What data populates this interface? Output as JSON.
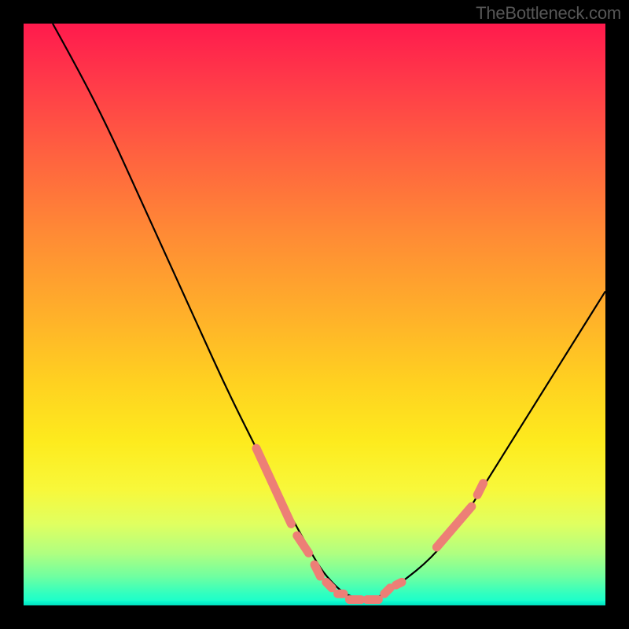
{
  "watermark": "TheBottleneck.com",
  "chart_data": {
    "type": "line",
    "title": "",
    "xlabel": "",
    "ylabel": "",
    "xlim": [
      0,
      100
    ],
    "ylim": [
      0,
      100
    ],
    "grid": false,
    "legend": false,
    "background_gradient": {
      "top": "#ff1a4d",
      "bottom": "#10ffd0",
      "note": "vertical rainbow gradient red→orange→yellow→green"
    },
    "series": [
      {
        "name": "black-curve",
        "color": "#000000",
        "x": [
          5,
          10,
          15,
          20,
          25,
          30,
          35,
          40,
          45,
          50,
          52,
          55,
          58,
          60,
          62,
          65,
          70,
          75,
          80,
          85,
          90,
          95,
          100
        ],
        "y": [
          100,
          91,
          81,
          70,
          59,
          48,
          37,
          27,
          17,
          8,
          5,
          2,
          1,
          1,
          2,
          4,
          8,
          14,
          22,
          30,
          38,
          46,
          54
        ]
      },
      {
        "name": "salmon-dashes",
        "color": "#ed7f76",
        "note": "thick dashed highlight segments on the lower portion of the curve",
        "segments": [
          {
            "from": {
              "x": 40,
              "y": 27
            },
            "to": {
              "x": 46,
              "y": 14
            }
          },
          {
            "from": {
              "x": 47,
              "y": 12
            },
            "to": {
              "x": 49,
              "y": 9
            }
          },
          {
            "from": {
              "x": 50,
              "y": 7
            },
            "to": {
              "x": 51,
              "y": 5
            }
          },
          {
            "from": {
              "x": 52,
              "y": 4
            },
            "to": {
              "x": 53,
              "y": 3
            }
          },
          {
            "from": {
              "x": 54,
              "y": 2
            },
            "to": {
              "x": 55,
              "y": 2
            }
          },
          {
            "from": {
              "x": 56,
              "y": 1
            },
            "to": {
              "x": 58,
              "y": 1
            }
          },
          {
            "from": {
              "x": 59,
              "y": 1
            },
            "to": {
              "x": 61,
              "y": 1
            }
          },
          {
            "from": {
              "x": 62,
              "y": 2
            },
            "to": {
              "x": 63,
              "y": 3
            }
          },
          {
            "from": {
              "x": 64,
              "y": 3.5
            },
            "to": {
              "x": 65,
              "y": 4
            }
          },
          {
            "from": {
              "x": 71,
              "y": 10
            },
            "to": {
              "x": 77,
              "y": 17
            }
          },
          {
            "from": {
              "x": 78,
              "y": 19
            },
            "to": {
              "x": 79,
              "y": 21
            }
          }
        ]
      }
    ]
  }
}
